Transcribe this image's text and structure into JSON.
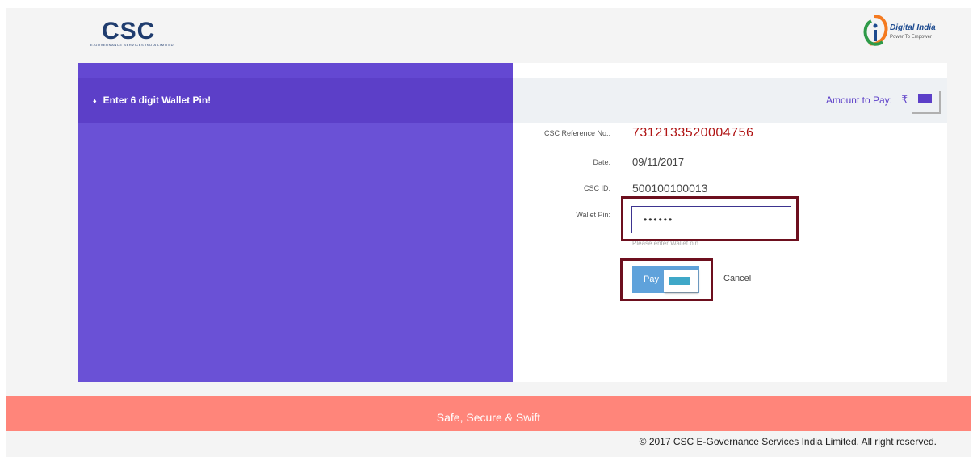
{
  "header": {
    "csc_logo_text": "CSC",
    "csc_logo_subtext": "E-GOVERNANCE SERVICES INDIA LIMITED",
    "digital_india_text": "Digital India",
    "digital_india_tagline": "Power To Empower"
  },
  "left": {
    "instruction": "Enter 6 digit Wallet Pin!",
    "bullet_icon": "diamond-icon"
  },
  "amount": {
    "label": "Amount to Pay:",
    "currency_symbol": "₹"
  },
  "form": {
    "ref_label": "CSC Reference No.:",
    "ref_value": "7312133520004756",
    "date_label": "Date:",
    "date_value": "09/11/2017",
    "cscid_label": "CSC ID:",
    "cscid_value": "500100100013",
    "pin_label": "Wallet Pin:",
    "pin_value": "••••••",
    "pin_hint": "Please enter Wallet pin"
  },
  "actions": {
    "pay_label": "Pay",
    "cancel_label": "Cancel"
  },
  "footer": {
    "tagline": "Safe, Secure & Swift",
    "copyright": "© 2017 CSC E-Governance Services India Limited. All right reserved."
  },
  "colors": {
    "left_panel": "#6a51d6",
    "ref_number": "#b01414",
    "footer": "#ff857a",
    "highlight_border": "#6d0f1e"
  }
}
